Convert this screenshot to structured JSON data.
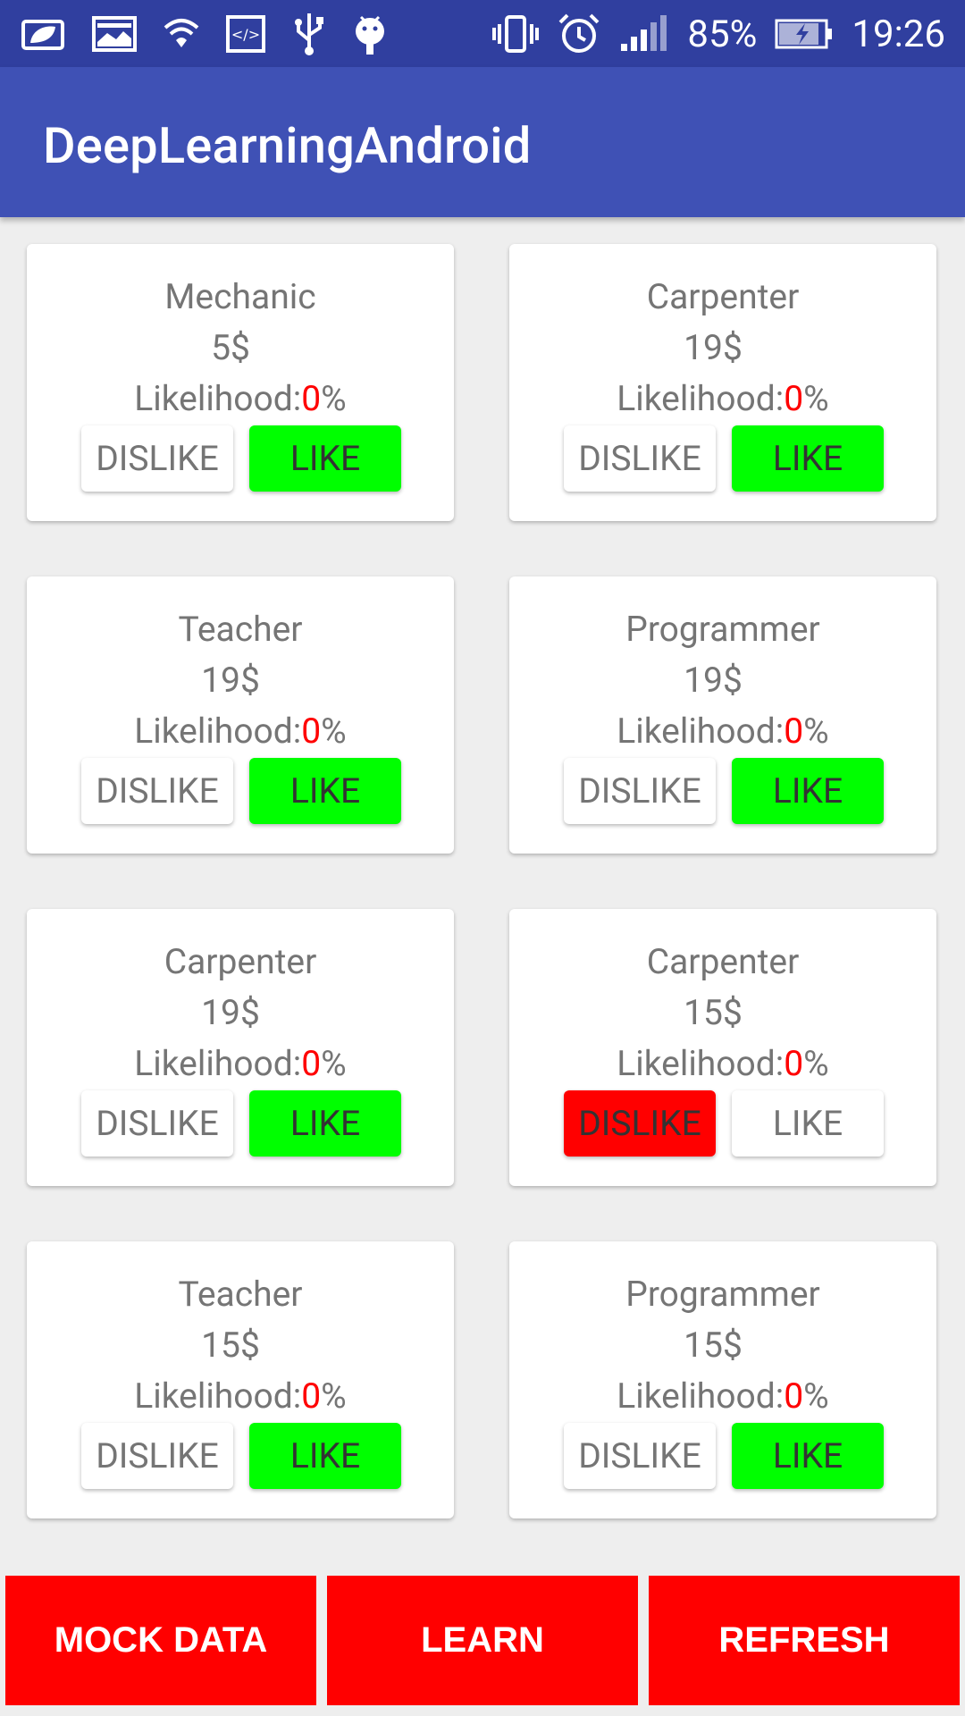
{
  "status_bar": {
    "battery_percent": "85%",
    "time": "19:26",
    "icons": [
      "leaf-icon",
      "image-icon",
      "wifi-icon",
      "code-icon",
      "usb-icon",
      "android-icon",
      "vibrate-icon",
      "alarm-icon",
      "signal-icon",
      "battery-charging-icon"
    ]
  },
  "app_bar": {
    "title": "DeepLearningAndroid"
  },
  "cards": [
    {
      "title": "Mechanic",
      "price": "5$",
      "likelihood_label": "Likelihood:",
      "likelihood_value": "0",
      "likelihood_unit": "%",
      "dislike": "DISLIKE",
      "like": "LIKE",
      "selected": "like"
    },
    {
      "title": "Carpenter",
      "price": "19$",
      "likelihood_label": "Likelihood:",
      "likelihood_value": "0",
      "likelihood_unit": "%",
      "dislike": "DISLIKE",
      "like": "LIKE",
      "selected": "like"
    },
    {
      "title": "Teacher",
      "price": "19$",
      "likelihood_label": "Likelihood:",
      "likelihood_value": "0",
      "likelihood_unit": "%",
      "dislike": "DISLIKE",
      "like": "LIKE",
      "selected": "like"
    },
    {
      "title": "Programmer",
      "price": "19$",
      "likelihood_label": "Likelihood:",
      "likelihood_value": "0",
      "likelihood_unit": "%",
      "dislike": "DISLIKE",
      "like": "LIKE",
      "selected": "like"
    },
    {
      "title": "Carpenter",
      "price": "19$",
      "likelihood_label": "Likelihood:",
      "likelihood_value": "0",
      "likelihood_unit": "%",
      "dislike": "DISLIKE",
      "like": "LIKE",
      "selected": "like"
    },
    {
      "title": "Carpenter",
      "price": "15$",
      "likelihood_label": "Likelihood:",
      "likelihood_value": "0",
      "likelihood_unit": "%",
      "dislike": "DISLIKE",
      "like": "LIKE",
      "selected": "dislike"
    },
    {
      "title": "Teacher",
      "price": "15$",
      "likelihood_label": "Likelihood:",
      "likelihood_value": "0",
      "likelihood_unit": "%",
      "dislike": "DISLIKE",
      "like": "LIKE",
      "selected": "like"
    },
    {
      "title": "Programmer",
      "price": "15$",
      "likelihood_label": "Likelihood:",
      "likelihood_value": "0",
      "likelihood_unit": "%",
      "dislike": "DISLIKE",
      "like": "LIKE",
      "selected": "like"
    }
  ],
  "bottom_buttons": {
    "mock_data": "MOCK DATA",
    "learn": "LEARN",
    "refresh": "REFRESH"
  },
  "colors": {
    "status_bar": "#303f9f",
    "app_bar": "#3f51b5",
    "like_active": "#00ff00",
    "dislike_active": "#ff0000",
    "likelihood_value": "#ff0000",
    "bottom_button": "#ff0000"
  }
}
